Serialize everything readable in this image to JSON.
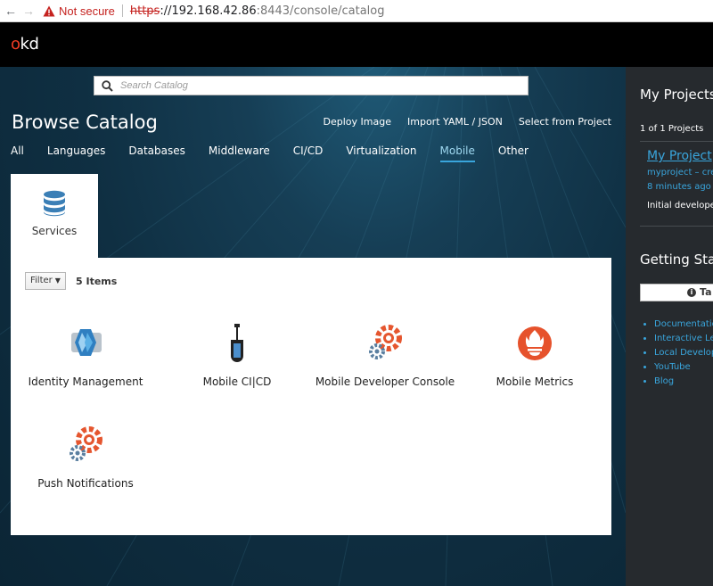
{
  "browser": {
    "back": "←",
    "forward": "→",
    "security_label": "Not secure",
    "url_scheme": "https",
    "url_host": "://192.168.42.86",
    "url_path": ":8443/console/catalog"
  },
  "header": {
    "logo_prefix": "o",
    "logo_rest": "kd"
  },
  "search": {
    "placeholder": "Search Catalog"
  },
  "page": {
    "title": "Browse Catalog",
    "actions": [
      "Deploy Image",
      "Import YAML / JSON",
      "Select from Project"
    ]
  },
  "categories": [
    "All",
    "Languages",
    "Databases",
    "Middleware",
    "CI/CD",
    "Virtualization",
    "Mobile",
    "Other"
  ],
  "active_category": "Mobile",
  "subcategory": {
    "label": "Services"
  },
  "filter": {
    "label": "Filter",
    "count": "5 Items"
  },
  "items": [
    {
      "name": "Identity Management",
      "icon": "keycloak-icon"
    },
    {
      "name": "Mobile CI|CD",
      "icon": "jenkins-icon"
    },
    {
      "name": "Mobile Developer Console",
      "icon": "gears-icon"
    },
    {
      "name": "Mobile Metrics",
      "icon": "prometheus-icon"
    },
    {
      "name": "Push Notifications",
      "icon": "gears-icon"
    }
  ],
  "sidebar": {
    "projects_heading": "My Projects",
    "project_count": "1 of 1 Projects",
    "project_name": "My Project",
    "project_meta1": "myproject – crea",
    "project_meta2": "8 minutes ago",
    "project_desc": "Initial developer",
    "getting_started": "Getting Start",
    "tour_label": "Ta",
    "links": [
      "Documentation",
      "Interactive Lea",
      "Local Develop",
      "YouTube",
      "Blog"
    ]
  },
  "colors": {
    "accent": "#39a5dc",
    "okd_red": "#ef3c24",
    "masthead": "#000000",
    "sidebar": "#262a2e"
  }
}
